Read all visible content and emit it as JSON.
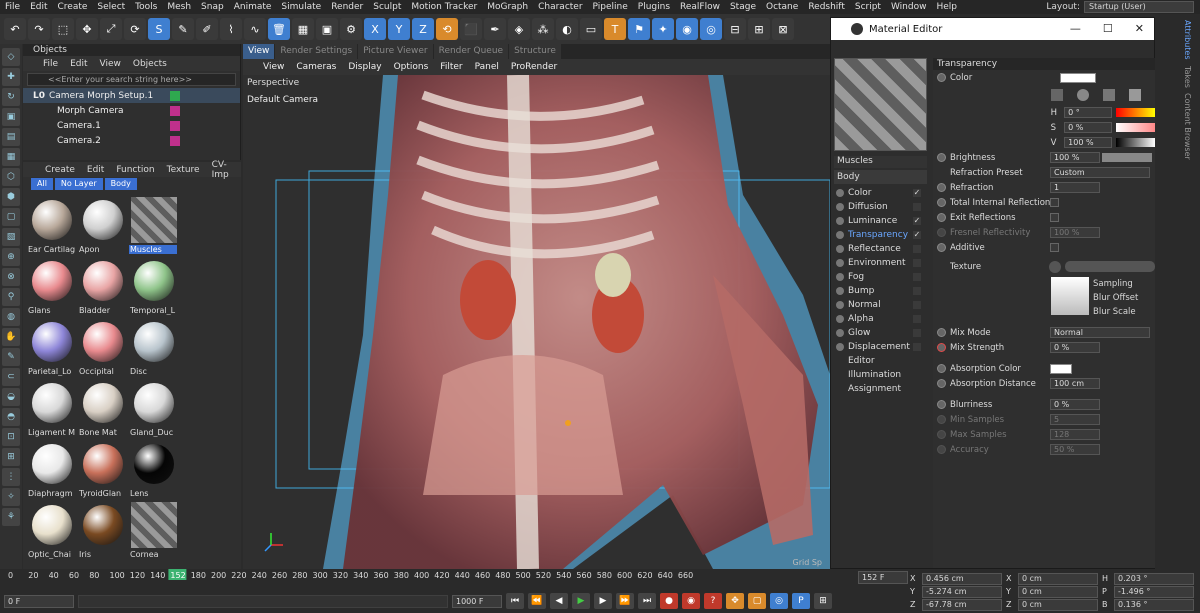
{
  "menubar": {
    "items": [
      "File",
      "Edit",
      "Create",
      "Select",
      "Tools",
      "Mesh",
      "Snap",
      "Animate",
      "Simulate",
      "Render",
      "Sculpt",
      "Motion Tracker",
      "MoGraph",
      "Character",
      "Pipeline",
      "Plugins",
      "RealFlow",
      "Stage",
      "Octane",
      "Redshift",
      "Script",
      "Window",
      "Help"
    ],
    "layout_label": "Layout:",
    "layout_value": "Startup (User)"
  },
  "objects": {
    "title": "Objects",
    "menu": [
      "File",
      "Edit",
      "View",
      "Objects"
    ],
    "search_placeholder": "<<Enter your search string here>>",
    "rows": [
      {
        "name": "Camera Morph Setup.1",
        "prefix": "L0"
      },
      {
        "name": "Morph Camera"
      },
      {
        "name": "Camera.1"
      },
      {
        "name": "Camera.2"
      }
    ]
  },
  "materials": {
    "menu": [
      "Create",
      "Edit",
      "Function",
      "Texture",
      "CV-Imp"
    ],
    "filters": [
      "All",
      "No Layer",
      "Body"
    ],
    "items": [
      {
        "label": "Ear Cartilag",
        "color": "#b8a89a"
      },
      {
        "label": "Apon",
        "color": "#cfcfcf"
      },
      {
        "label": "Muscles",
        "color": "stripe",
        "selected": true
      },
      {
        "label": "Glans",
        "color": "#e88a8e"
      },
      {
        "label": "Bladder",
        "color": "#e8a4a4"
      },
      {
        "label": "Temporal_L",
        "color": "#8fc48a"
      },
      {
        "label": "Parietal_Lo",
        "color": "#8e86d8"
      },
      {
        "label": "Occipital",
        "color": "#e88a8e"
      },
      {
        "label": "Disc",
        "color": "#b8c4cc"
      },
      {
        "label": "Ligament M",
        "color": "#d8d8d8"
      },
      {
        "label": "Bone Mat",
        "color": "#d8cfc4"
      },
      {
        "label": "Gland_Duc",
        "color": "#d8d8d8"
      },
      {
        "label": "Diaphragm",
        "color": "#e8e8e8"
      },
      {
        "label": "TyroidGlan",
        "color": "#c8705a"
      },
      {
        "label": "Lens",
        "color": "#050505"
      },
      {
        "label": "Optic_Chai",
        "color": "#e8e0cc"
      },
      {
        "label": "Iris",
        "color": "#7a4a22"
      },
      {
        "label": "Cornea",
        "color": "stripe"
      }
    ]
  },
  "view": {
    "tabs": [
      "View",
      "Render Settings",
      "Picture Viewer",
      "Render Queue",
      "Structure"
    ],
    "menu": [
      "View",
      "Cameras",
      "Display",
      "Options",
      "Filter",
      "Panel",
      "ProRender"
    ],
    "label": "Perspective",
    "camera": "Default Camera",
    "grid": "Grid Sp"
  },
  "timeline": {
    "ticks": [
      "0",
      "20",
      "40",
      "60",
      "80",
      "100",
      "120",
      "140",
      "152",
      "180",
      "200",
      "220",
      "240",
      "260",
      "280",
      "300",
      "320",
      "340",
      "360",
      "380",
      "400",
      "420",
      "440",
      "460",
      "480",
      "500",
      "520",
      "540",
      "560",
      "580",
      "600",
      "620",
      "640",
      "660"
    ],
    "current": "152",
    "start": "0 F",
    "end": "1000 F",
    "frame_box": "152 F"
  },
  "coords": {
    "rows": [
      {
        "l1": "X",
        "v1": "0.456 cm",
        "l2": "X",
        "v2": "0 cm",
        "l3": "H",
        "v3": "0.203 °"
      },
      {
        "l1": "Y",
        "v1": "-5.274 cm",
        "l2": "Y",
        "v2": "0 cm",
        "l3": "P",
        "v3": "-1.496 °"
      },
      {
        "l1": "Z",
        "v1": "-67.78 cm",
        "l2": "Z",
        "v2": "0 cm",
        "l3": "B",
        "v3": "0.136 °"
      }
    ]
  },
  "matwin": {
    "title": "Material Editor",
    "name": "Muscles",
    "body": "Body",
    "channels": [
      {
        "name": "Color",
        "on": true
      },
      {
        "name": "Diffusion",
        "on": false
      },
      {
        "name": "Luminance",
        "on": true
      },
      {
        "name": "Transparency",
        "on": true,
        "active": true
      },
      {
        "name": "Reflectance",
        "on": false
      },
      {
        "name": "Environment",
        "on": false
      },
      {
        "name": "Fog",
        "on": false
      },
      {
        "name": "Bump",
        "on": false
      },
      {
        "name": "Normal",
        "on": false
      },
      {
        "name": "Alpha",
        "on": false
      },
      {
        "name": "Glow",
        "on": false
      },
      {
        "name": "Displacement",
        "on": false
      }
    ],
    "extras": [
      "Editor",
      "Illumination",
      "Assignment"
    ],
    "section": "Transparency",
    "color_label": "Color",
    "hsv": [
      {
        "l": "H",
        "v": "0 °"
      },
      {
        "l": "S",
        "v": "0 %"
      },
      {
        "l": "V",
        "v": "100 %"
      }
    ],
    "brightness": {
      "label": "Brightness",
      "value": "100 %"
    },
    "refraction_preset": {
      "label": "Refraction Preset",
      "value": "Custom"
    },
    "refraction": {
      "label": "Refraction",
      "value": "1"
    },
    "tir": "Total Internal Reflection",
    "exit": "Exit Reflections",
    "fresnel": {
      "label": "Fresnel Reflectivity",
      "value": "100 %"
    },
    "additive": "Additive",
    "texture": "Texture",
    "sampling": [
      "Sampling",
      "Blur Offset",
      "Blur Scale"
    ],
    "mixmode": {
      "label": "Mix Mode",
      "value": "Normal"
    },
    "mixstrength": {
      "label": "Mix Strength",
      "value": "0 %"
    },
    "abscolor": "Absorption Color",
    "absdist": {
      "label": "Absorption Distance",
      "value": "100 cm"
    },
    "blur": {
      "label": "Blurriness",
      "value": "0 %"
    },
    "minsamples": {
      "label": "Min Samples",
      "value": "5"
    },
    "maxsamples": {
      "label": "Max Samples",
      "value": "128"
    },
    "accuracy": {
      "label": "Accuracy",
      "value": "50 %"
    }
  },
  "rightstrip": {
    "tabs": [
      "Attributes",
      "Takes",
      "Content Browser"
    ]
  }
}
